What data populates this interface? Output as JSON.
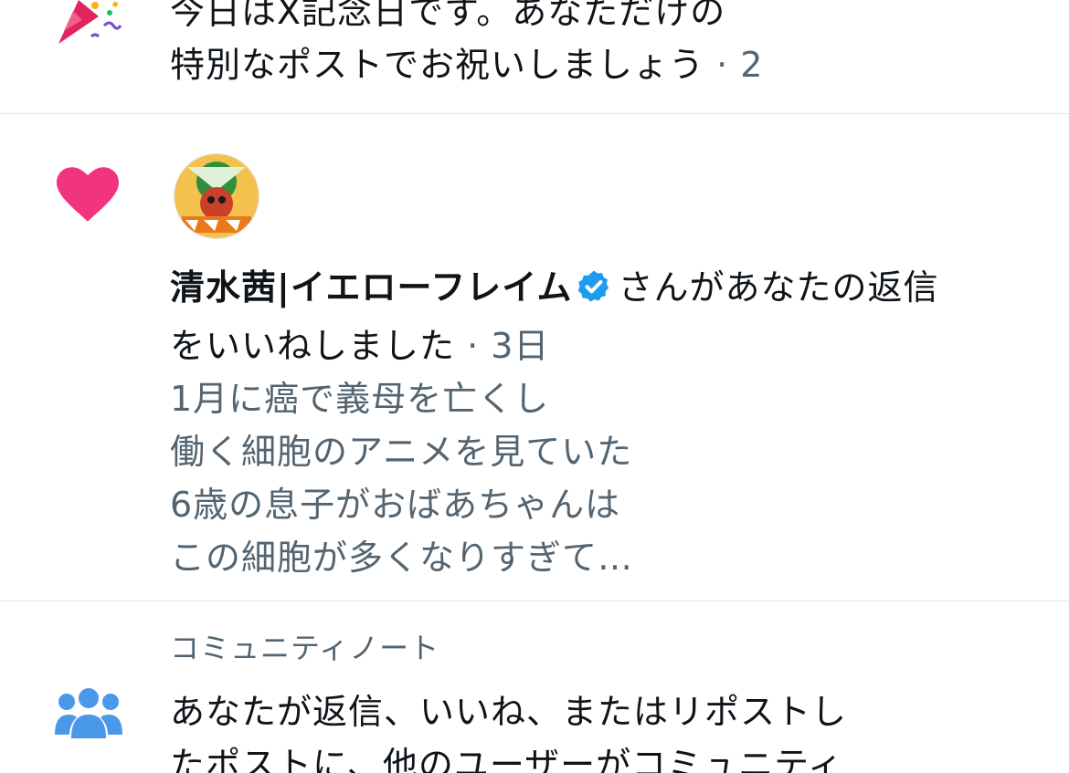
{
  "notifications": {
    "anniversary": {
      "line1": "今日はX記念日です。あなただけの",
      "line2": "特別なポストでお祝いしましょう",
      "meta": " · 2",
      "icon": "party-popper-icon"
    },
    "like": {
      "user_name": "清水茜|イエローフレイム",
      "action_suffix": "さんがあなたの返信",
      "action_line2": "をいいねしました",
      "time": " · 3日",
      "preview_lines": [
        "1月に癌で義母を亡くし",
        "働く細胞のアニメを見ていた",
        "6歳の息子がおばあちゃんは",
        "この細胞が多くなりすぎて…"
      ],
      "icon": "heart-icon",
      "heart_color": "#f0347e",
      "verified_color": "#1d9bf0"
    },
    "community": {
      "label": "コミュニティノート",
      "line1": "あなたが返信、いいね、またはリポストし",
      "line2": "たポストに、他のユーザーがコミュニティ",
      "icon": "people-icon",
      "icon_color": "#4a99e9"
    }
  }
}
